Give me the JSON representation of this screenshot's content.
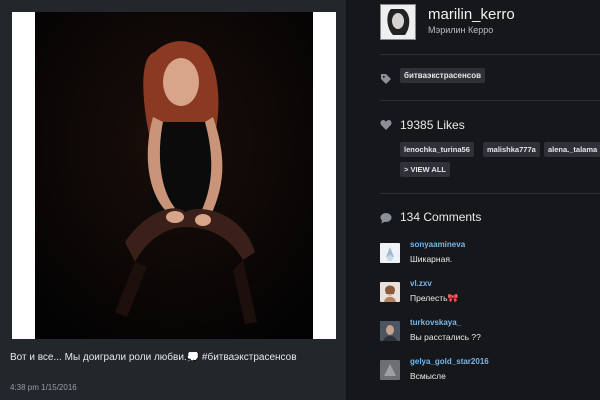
{
  "post": {
    "caption": "Вот и все... Мы доиграли роли любви.💭 #битваэкстрасенсов",
    "timestamp": "4:38 pm 1/15/2016"
  },
  "profile": {
    "username": "marilin_kerro",
    "full_name": "Мэрилин Керро"
  },
  "tags": [
    "битваэкстрасенсов"
  ],
  "likes": {
    "label": "19385 Likes",
    "likers": [
      "lenochka_turina56",
      "malishka777a",
      "alena._talama"
    ],
    "view_all": "> VIEW ALL"
  },
  "comments": {
    "label": "134 Comments",
    "items": [
      {
        "user": "sonyaamineva",
        "text": "Шикарная.",
        "avatar_color": "#c9d7e6"
      },
      {
        "user": "vl.zxv",
        "text": "Прелесть🎀",
        "avatar_color": "#c8a58a"
      },
      {
        "user": "turkovskaya_",
        "text": "Вы расстались ??",
        "avatar_color": "#5f6b7a"
      },
      {
        "user": "gelya_gold_star2016",
        "text": "Всмысле",
        "avatar_color": "#6d6f73"
      }
    ]
  },
  "icons": {
    "tag": "tag-icon",
    "heart": "heart-icon",
    "comment": "comment-bubble-icon"
  },
  "colors": {
    "link": "#7ab6e6",
    "chip": "#2e3137",
    "background": "#15171a"
  }
}
